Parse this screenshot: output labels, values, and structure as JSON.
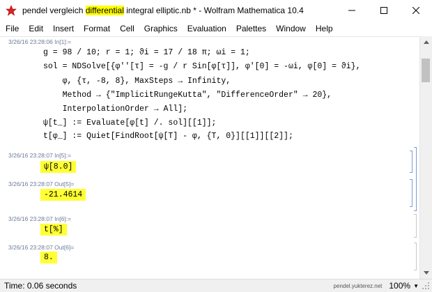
{
  "window": {
    "title_prefix": "pendel vergleich ",
    "title_highlight": "differential",
    "title_suffix": " integral elliptic.nb * - Wolfram Mathematica 10.4"
  },
  "menu": [
    "File",
    "Edit",
    "Insert",
    "Format",
    "Cell",
    "Graphics",
    "Evaluation",
    "Palettes",
    "Window",
    "Help"
  ],
  "cells": {
    "c1_label": "3/26/16 23:28:06 In[1]:=",
    "c1_lines": [
      "g = 98 / 10; r = 1; ϑi = 17 / 18 π; ωi = 1;",
      "sol = NDSolve[{φ''[τ] = -g / r Sin[φ[τ]], φ'[0] = -ωi, φ[0] = ϑi},",
      "    φ, {τ, -8, 8}, MaxSteps → Infinity,",
      "    Method → {\"ImplicitRungeKutta\", \"DifferenceOrder\" → 20},",
      "    InterpolationOrder → All];",
      "ψ[t_] := Evaluate[φ[t] /. sol][[1]];",
      "t[φ_] := Quiet[FindRoot[ψ[T] - φ, {T, 0}][[1]][[2]];"
    ],
    "c2_label": "3/26/16 23:28:07 In[5]:=",
    "c2_input": "ψ[8.0]",
    "c3_label": "3/26/16 23:28:07 Out[5]=",
    "c3_output": "-21.4614",
    "c4_label": "3/26/16 23:28:07 In[6]:=",
    "c4_input": "t[%]",
    "c5_label": "3/26/16 23:28:07 Out[6]=",
    "c5_output": "8."
  },
  "status": {
    "time": "Time: 0.06 seconds",
    "host": "pendel.yukterez.net",
    "zoom": "100%"
  }
}
